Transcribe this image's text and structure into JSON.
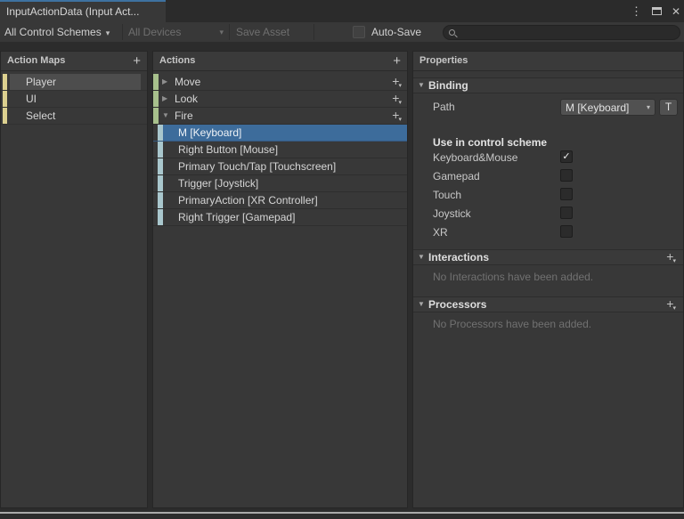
{
  "window": {
    "tab_title": "InputActionData (Input Act..."
  },
  "icons": {
    "menu_dots": "⋮",
    "close": "✕",
    "dropdown_arrow": "▾",
    "collapsed_arrow": "▶",
    "expanded_arrow": "▼",
    "plus": "+",
    "check": "✓"
  },
  "toolbar": {
    "control_schemes_label": "All Control Schemes",
    "devices_label": "All Devices",
    "save_asset_label": "Save Asset",
    "auto_save_label": "Auto-Save",
    "search_value": ""
  },
  "action_maps": {
    "title": "Action Maps",
    "items": [
      {
        "label": "Player",
        "selected": true
      },
      {
        "label": "UI",
        "selected": false
      },
      {
        "label": "Select",
        "selected": false
      }
    ]
  },
  "actions": {
    "title": "Actions",
    "items": [
      {
        "label": "Move",
        "expanded": false
      },
      {
        "label": "Look",
        "expanded": false
      },
      {
        "label": "Fire",
        "expanded": true
      }
    ],
    "fire_bindings": [
      {
        "label": "M [Keyboard]",
        "selected": true
      },
      {
        "label": "Right Button [Mouse]",
        "selected": false
      },
      {
        "label": "Primary Touch/Tap [Touchscreen]",
        "selected": false
      },
      {
        "label": "Trigger [Joystick]",
        "selected": false
      },
      {
        "label": "PrimaryAction [XR Controller]",
        "selected": false
      },
      {
        "label": "Right Trigger [Gamepad]",
        "selected": false
      }
    ]
  },
  "properties": {
    "title": "Properties",
    "binding": {
      "title": "Binding",
      "path_label": "Path",
      "path_value": "M [Keyboard]",
      "t_button_label": "T",
      "control_scheme_heading": "Use in control scheme",
      "schemes": [
        {
          "label": "Keyboard&Mouse",
          "checked": true
        },
        {
          "label": "Gamepad",
          "checked": false
        },
        {
          "label": "Touch",
          "checked": false
        },
        {
          "label": "Joystick",
          "checked": false
        },
        {
          "label": "XR",
          "checked": false
        }
      ]
    },
    "interactions": {
      "title": "Interactions",
      "empty_text": "No Interactions have been added."
    },
    "processors": {
      "title": "Processors",
      "empty_text": "No Processors have been added."
    }
  },
  "colors": {
    "selection_blue": "#3d6c9b",
    "action_map_bar": "#dcd08f",
    "action_bar": "#a7c08c",
    "binding_bar": "#a9c7cd",
    "tab_accent": "#3e72a0"
  }
}
